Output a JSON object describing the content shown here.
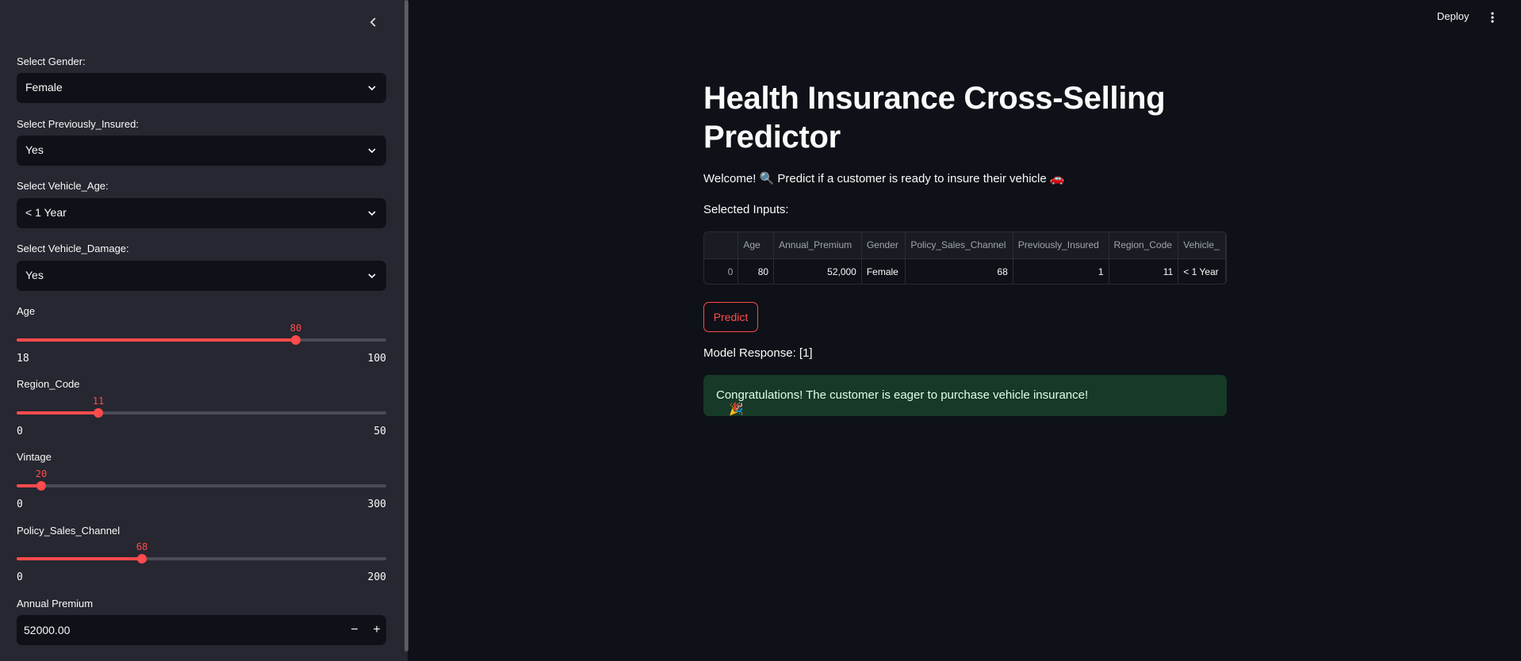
{
  "header": {
    "deploy_label": "Deploy"
  },
  "sidebar": {
    "gender": {
      "label": "Select Gender:",
      "value": "Female"
    },
    "previously_insured": {
      "label": "Select Previously_Insured:",
      "value": "Yes"
    },
    "vehicle_age": {
      "label": "Select Vehicle_Age:",
      "value": "< 1 Year"
    },
    "vehicle_damage": {
      "label": "Select Vehicle_Damage:",
      "value": "Yes"
    },
    "age": {
      "label": "Age",
      "value": 80,
      "min": 18,
      "max": 100
    },
    "region_code": {
      "label": "Region_Code",
      "value": 11,
      "min": 0,
      "max": 50
    },
    "vintage": {
      "label": "Vintage",
      "value": 20,
      "min": 0,
      "max": 300
    },
    "policy_sales_channel": {
      "label": "Policy_Sales_Channel",
      "value": 68,
      "min": 0,
      "max": 200
    },
    "annual_premium": {
      "label": "Annual Premium",
      "value": "52000.00",
      "minus": "−",
      "plus": "+"
    }
  },
  "main": {
    "title": "Health Insurance Cross-Selling Predictor",
    "welcome": "Welcome! 🔍 Predict if a customer is ready to insure their vehicle 🚗",
    "selected_inputs_label": "Selected Inputs:",
    "table": {
      "columns": [
        "",
        "Age",
        "Annual_Premium",
        "Gender",
        "Policy_Sales_Channel",
        "Previously_Insured",
        "Region_Code",
        "Vehicle_"
      ],
      "row": [
        "0",
        "80",
        "52,000",
        "Female",
        "68",
        "1",
        "11",
        "< 1 Year"
      ]
    },
    "predict_label": "Predict",
    "model_response": "Model Response: [1]",
    "success_icon": "🎉",
    "success_message": "Congratulations! The customer is eager to purchase vehicle insurance!"
  },
  "colors": {
    "accent": "#ff4b4b",
    "background": "#0e1117",
    "sidebar": "#262730",
    "success_bg": "#173928"
  }
}
